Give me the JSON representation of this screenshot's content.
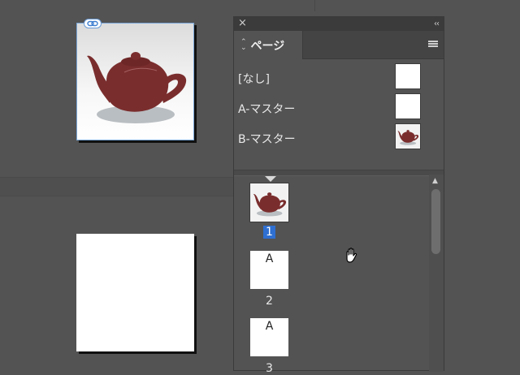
{
  "panel": {
    "close_glyph": "×",
    "collapse_glyph": "‹‹",
    "tab_label": "ページ",
    "menu_icon": "panel-menu-icon"
  },
  "masters": [
    {
      "label": "[なし]",
      "thumb": "blank"
    },
    {
      "label": "A-マスター",
      "thumb": "blank"
    },
    {
      "label": "B-マスター",
      "thumb": "teapot"
    }
  ],
  "pages": [
    {
      "number": "1",
      "letter": "",
      "thumb": "teapot",
      "selected": true
    },
    {
      "number": "2",
      "letter": "A",
      "thumb": "blank",
      "selected": false
    },
    {
      "number": "3",
      "letter": "A",
      "thumb": "blank",
      "selected": false
    }
  ],
  "colors": {
    "teapot": "#7a2d2d",
    "selection": "#2e6fd1",
    "panel_bg": "#535353"
  }
}
